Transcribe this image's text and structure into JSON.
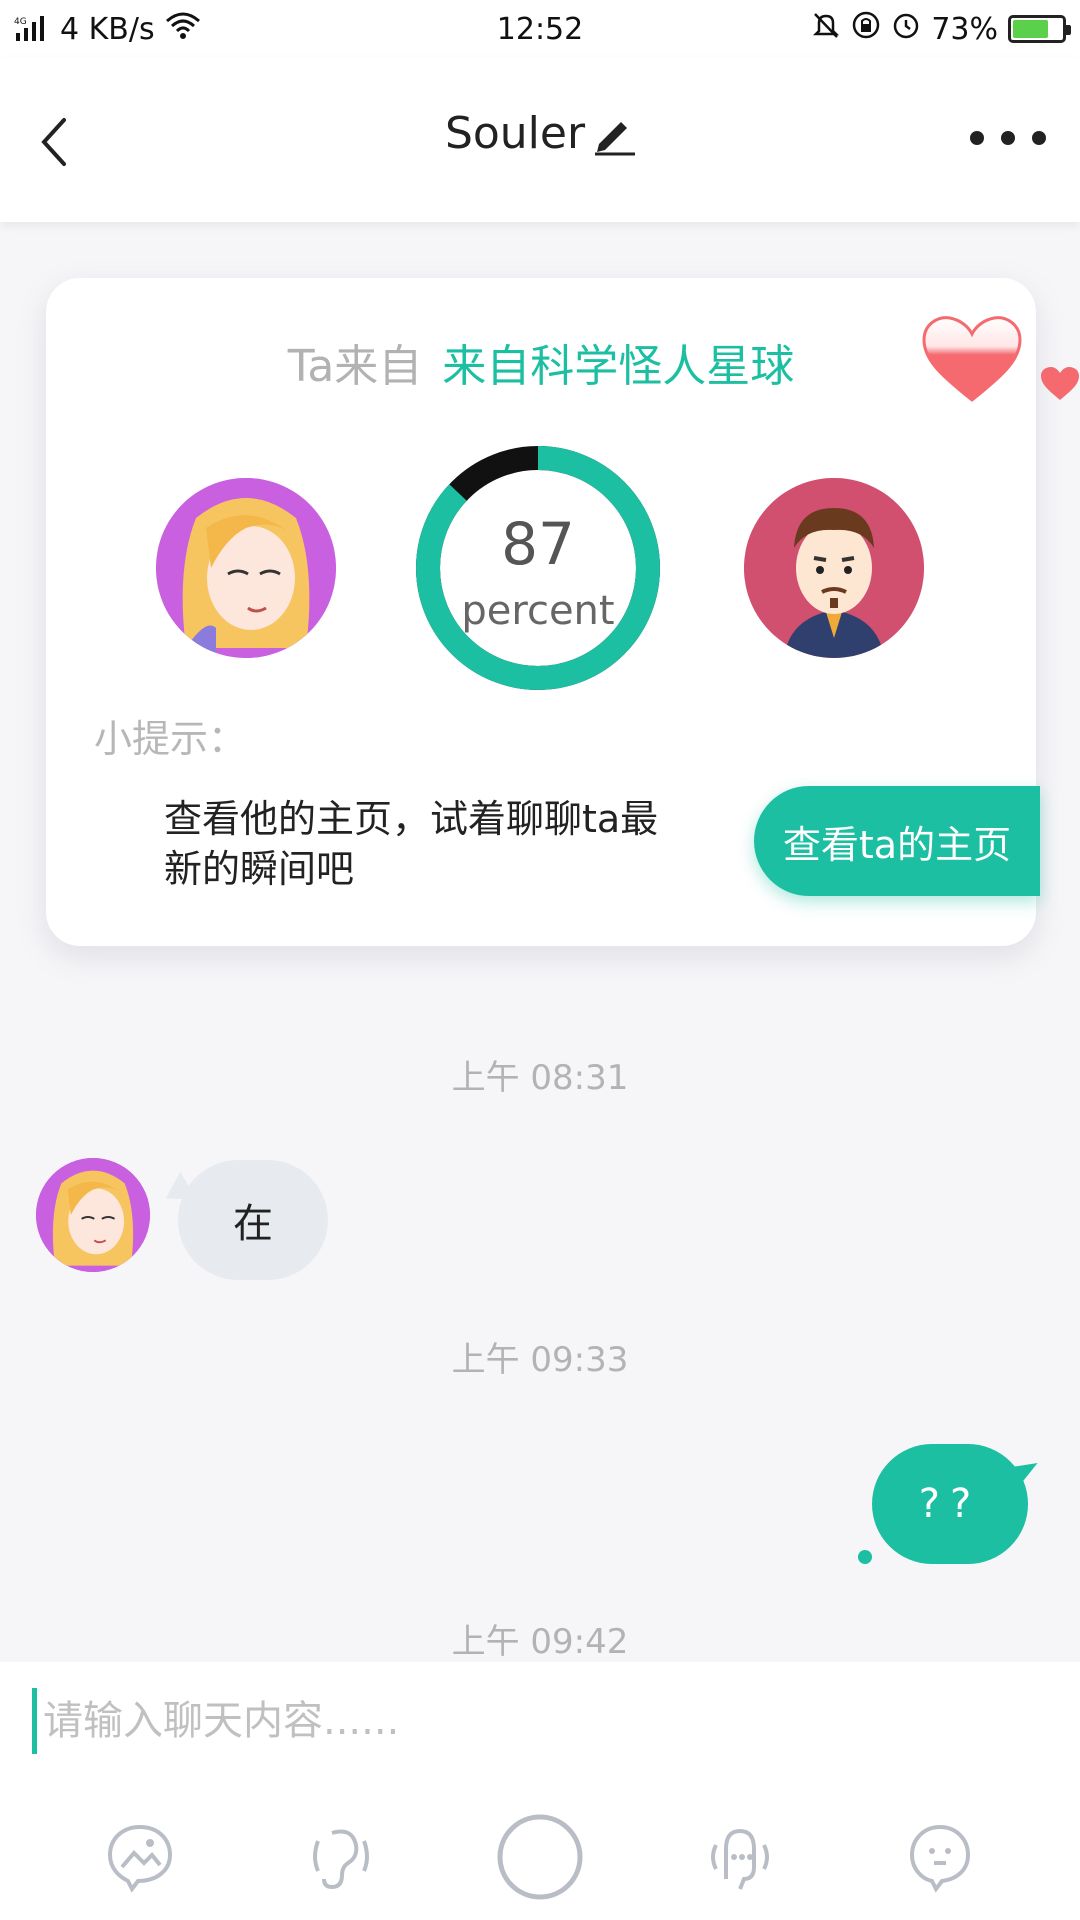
{
  "status_bar": {
    "network": "4G",
    "speed": "4 KB/s",
    "time": "12:52",
    "battery": "73%",
    "battery_level": 0.73
  },
  "header": {
    "title": "Souler"
  },
  "match_card": {
    "origin_prefix": "Ta来自",
    "origin_place": "来自科学怪人星球",
    "match_value": "87",
    "match_fraction": 0.87,
    "match_unit": "percent",
    "tip_label": "小提示：",
    "tip_text": "查看他的主页，试着聊聊ta最新的瞬间吧",
    "profile_button": "查看ta的主页"
  },
  "messages": [
    {
      "type": "time",
      "text": "上午 08:31"
    },
    {
      "type": "incoming",
      "text": "在"
    },
    {
      "type": "time",
      "text": "上午 09:33"
    },
    {
      "type": "outgoing",
      "text": "??"
    },
    {
      "type": "time",
      "text": "上午 09:42"
    }
  ],
  "input": {
    "placeholder": "请输入聊天内容......"
  },
  "toolbar": [
    "image-icon",
    "voice-icon",
    "record-icon",
    "voice-changer-icon",
    "emoji-icon"
  ],
  "colors": {
    "accent": "#1dbfa2",
    "heart": "#f46a6f",
    "incoming_bubble": "#e7ebef"
  }
}
